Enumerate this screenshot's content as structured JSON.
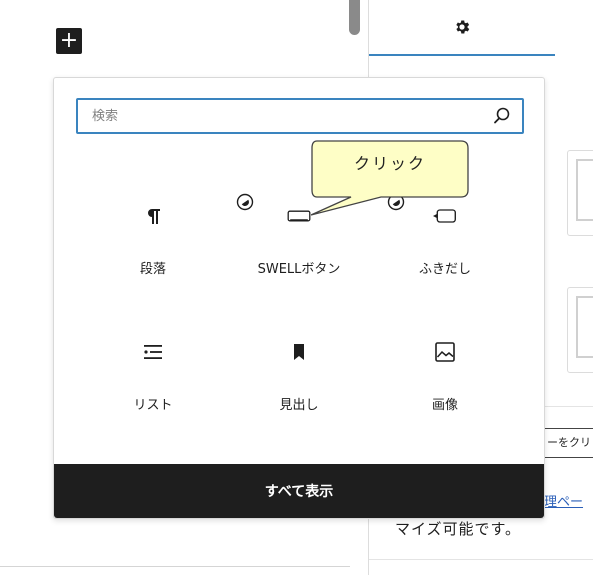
{
  "toolbar": {
    "add_block_label": "+"
  },
  "sidebar": {
    "settings_tab_icon": "gear-icon",
    "fragment_button_text": "ーをクリ",
    "fragment_link_text": "理ペー",
    "fragment_body_text": "マイズ可能です。"
  },
  "inserter": {
    "search": {
      "placeholder": "検索",
      "value": ""
    },
    "blocks": [
      {
        "label": "段落",
        "icon": "paragraph-icon"
      },
      {
        "label": "SWELLボタン",
        "icon": "button-icon"
      },
      {
        "label": "ふきだし",
        "icon": "speech-balloon-icon"
      },
      {
        "label": "リスト",
        "icon": "list-icon"
      },
      {
        "label": "見出し",
        "icon": "heading-bookmark-icon"
      },
      {
        "label": "画像",
        "icon": "image-icon"
      }
    ],
    "browse_all_label": "すべて表示"
  },
  "callout": {
    "text": "クリック",
    "fill": "#fefec6",
    "stroke": "#444444"
  },
  "colors": {
    "accent": "#3a84bf",
    "dark": "#1e1e1e"
  }
}
